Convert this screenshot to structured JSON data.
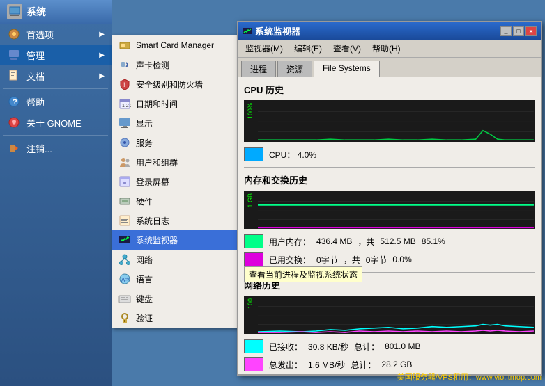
{
  "desktop": {
    "background_color": "#4a7aaa"
  },
  "system_menu": {
    "header": "系统",
    "items": [
      {
        "label": "首选项",
        "icon": "prefs",
        "has_arrow": true
      },
      {
        "label": "管理",
        "icon": "admin",
        "has_arrow": true,
        "active": true
      },
      {
        "label": "文档",
        "icon": "doc",
        "has_arrow": true
      },
      {
        "label": "帮助",
        "icon": "help",
        "has_arrow": false
      },
      {
        "label": "关于 GNOME",
        "icon": "gnome",
        "has_arrow": false
      },
      {
        "label": "注销...",
        "icon": "logout",
        "has_arrow": false
      }
    ]
  },
  "submenu": {
    "items": [
      {
        "label": "Smart Card Manager",
        "icon": "smartcard"
      },
      {
        "label": "声卡检测",
        "icon": "audio"
      },
      {
        "label": "安全级别和防火墙",
        "icon": "security"
      },
      {
        "label": "日期和时间",
        "icon": "datetime"
      },
      {
        "label": "显示",
        "icon": "display"
      },
      {
        "label": "服务",
        "icon": "services"
      },
      {
        "label": "用户和组群",
        "icon": "users"
      },
      {
        "label": "登录屏幕",
        "icon": "login"
      },
      {
        "label": "硬件",
        "icon": "hardware"
      },
      {
        "label": "系统日志",
        "icon": "syslog"
      },
      {
        "label": "系统监视器",
        "icon": "sysmon",
        "highlighted": true
      },
      {
        "label": "网络",
        "icon": "network"
      },
      {
        "label": "语言",
        "icon": "language"
      },
      {
        "label": "键盘",
        "icon": "keyboard"
      },
      {
        "label": "验证",
        "icon": "auth"
      }
    ]
  },
  "tooltip": "查看当前进程及监视系统状态",
  "sysmon_window": {
    "title": "系统监视器",
    "icon": "monitor-icon",
    "menu": {
      "items": [
        "监视器(M)",
        "编辑(E)",
        "查看(V)",
        "帮助(H)"
      ]
    },
    "tabs": [
      "进程",
      "资源",
      "File Systems"
    ],
    "active_tab": "File Systems",
    "cpu_section": {
      "title": "CPU 历史",
      "value": "CPU：  4.0%",
      "color": "#00aaff"
    },
    "memory_section": {
      "title": "内存和交换历史",
      "stats": [
        {
          "label": "用户内存：",
          "value": "436.4 MB",
          "mid": "，共",
          "total": "512.5 MB",
          "percent": "85.1%",
          "color": "#00ff88"
        },
        {
          "label": "已用交换：",
          "value": "0字节",
          "mid": "，共",
          "total": "0字节",
          "percent": "0.0%",
          "color": "#dd00dd"
        }
      ]
    },
    "network_section": {
      "title": "网络历史",
      "stats": [
        {
          "label": "已接收：",
          "value": "30.8 KB/秒",
          "mid": "总计：",
          "total": "801.0 MB",
          "color": "#00ffff"
        },
        {
          "label": "总发出：",
          "value": "1.6 MB/秒",
          "mid": "总计：",
          "total": "28.2 GB",
          "color": "#ff44ff"
        }
      ]
    }
  },
  "watermark": "美国服务器/VPS租用：www.vio.itmop.com"
}
